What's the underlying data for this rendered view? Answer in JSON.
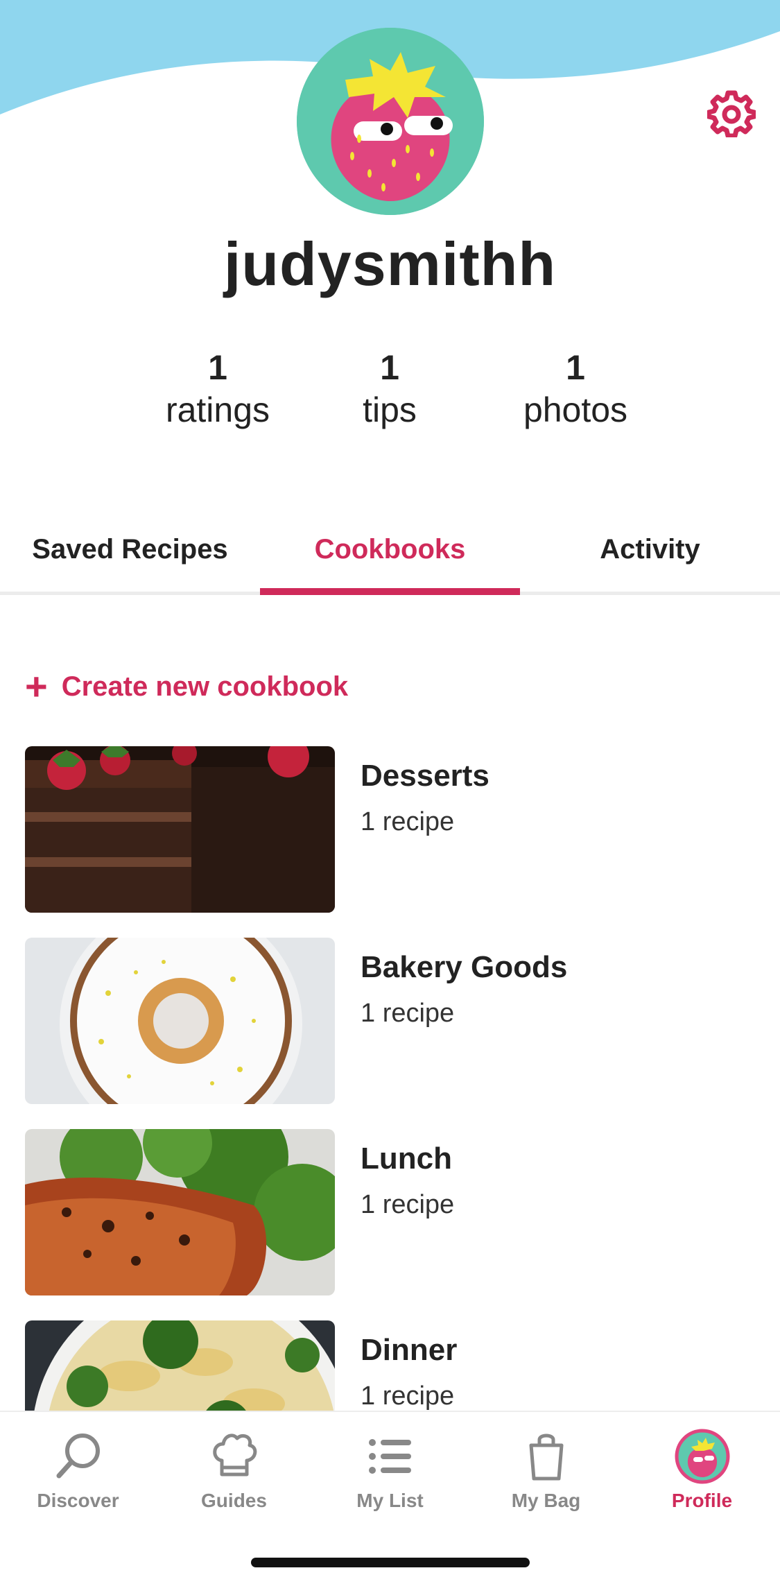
{
  "profile": {
    "username": "judysmithh",
    "stats": [
      {
        "value": "1",
        "label": "ratings"
      },
      {
        "value": "1",
        "label": "tips"
      },
      {
        "value": "1",
        "label": "photos"
      }
    ]
  },
  "tabs": [
    {
      "label": "Saved Recipes",
      "active": false
    },
    {
      "label": "Cookbooks",
      "active": true
    },
    {
      "label": "Activity",
      "active": false
    }
  ],
  "create_cookbook": {
    "icon": "plus-icon",
    "label": "Create new cookbook"
  },
  "cookbooks": [
    {
      "name": "Desserts",
      "count": "1 recipe"
    },
    {
      "name": "Bakery Goods",
      "count": "1 recipe"
    },
    {
      "name": "Lunch",
      "count": "1 recipe"
    },
    {
      "name": "Dinner",
      "count": "1 recipe"
    }
  ],
  "bottom_nav": [
    {
      "label": "Discover",
      "icon": "search-icon",
      "active": false
    },
    {
      "label": "Guides",
      "icon": "chef-hat-icon",
      "active": false
    },
    {
      "label": "My List",
      "icon": "list-icon",
      "active": false
    },
    {
      "label": "My Bag",
      "icon": "bag-icon",
      "active": false
    },
    {
      "label": "Profile",
      "icon": "avatar-icon",
      "active": true
    }
  ],
  "colors": {
    "accent": "#cf2a5a",
    "header_wave": "#8fd6ee",
    "avatar_bg": "#5ec9ae",
    "inactive_nav": "#888888"
  }
}
